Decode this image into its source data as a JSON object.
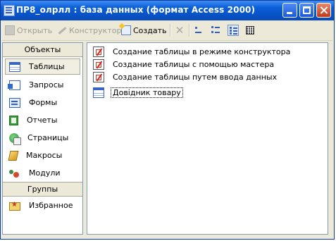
{
  "window": {
    "title": "ПР8_олрлл : база данных (формат Access 2000)"
  },
  "toolbar": {
    "open_label": "Открыть",
    "design_label": "Конструктор",
    "create_label": "Создать"
  },
  "objects_header": "Объекты",
  "groups_header": "Группы",
  "objects": [
    {
      "label": "Таблицы",
      "icon": "table-icon",
      "selected": true
    },
    {
      "label": "Запросы",
      "icon": "query-icon"
    },
    {
      "label": "Формы",
      "icon": "form-icon"
    },
    {
      "label": "Отчеты",
      "icon": "report-icon"
    },
    {
      "label": "Страницы",
      "icon": "page-icon"
    },
    {
      "label": "Макросы",
      "icon": "macro-icon"
    },
    {
      "label": "Модули",
      "icon": "module-icon"
    }
  ],
  "groups": [
    {
      "label": "Избранное",
      "icon": "favorites-icon"
    }
  ],
  "list": [
    {
      "label": "Создание таблицы в режиме конструктора",
      "icon": "design-wizard-icon"
    },
    {
      "label": "Создание таблицы с помощью мастера",
      "icon": "table-wizard-icon"
    },
    {
      "label": "Создание таблицы путем ввода данных",
      "icon": "data-entry-wizard-icon"
    },
    {
      "label": "Довідник товару",
      "icon": "table-icon",
      "focused": true
    }
  ],
  "colors": {
    "titlebar": "#0a5fd8",
    "panel_border": "#7f9db9",
    "window_bg": "#ece9d8"
  }
}
